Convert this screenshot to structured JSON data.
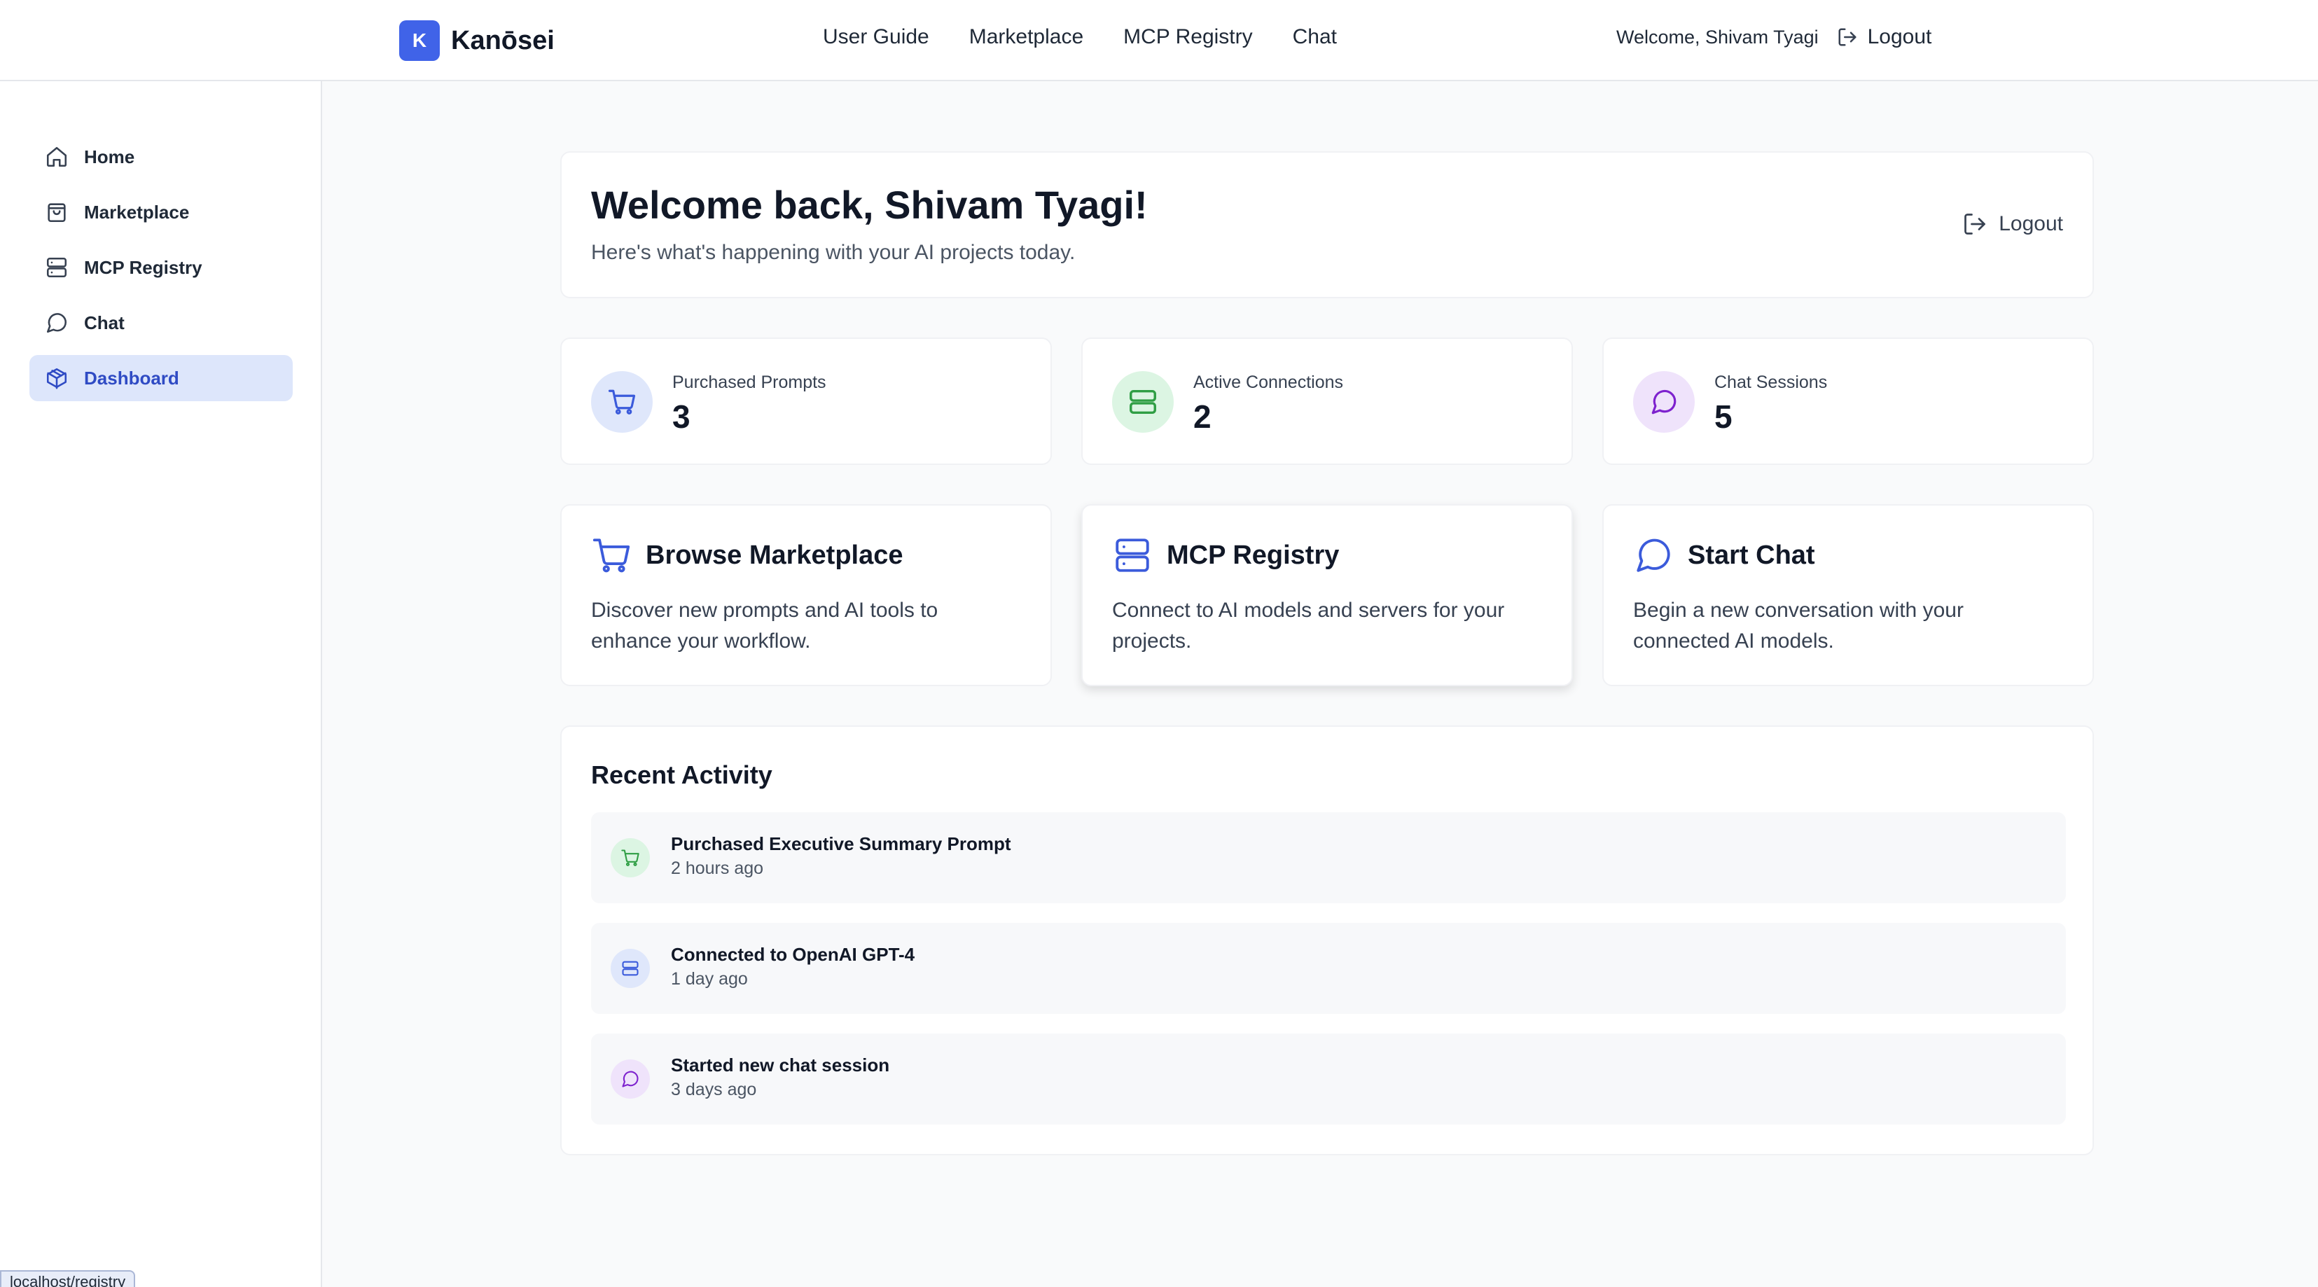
{
  "header": {
    "brand_letter": "K",
    "brand_name": "Kanōsei",
    "nav": [
      "User Guide",
      "Marketplace",
      "MCP Registry",
      "Chat"
    ],
    "welcome_text": "Welcome, Shivam Tyagi",
    "logout_label": "Logout"
  },
  "sidebar": {
    "items": [
      {
        "label": "Home",
        "icon": "home-icon"
      },
      {
        "label": "Marketplace",
        "icon": "bag-icon"
      },
      {
        "label": "MCP Registry",
        "icon": "server-icon"
      },
      {
        "label": "Chat",
        "icon": "chat-icon"
      },
      {
        "label": "Dashboard",
        "icon": "cube-icon",
        "active": true
      }
    ]
  },
  "main": {
    "welcome": {
      "title": "Welcome back, Shivam Tyagi!",
      "subtitle": "Here's what's happening with your AI projects today.",
      "logout_label": "Logout"
    },
    "stats": [
      {
        "label": "Purchased Prompts",
        "value": "3",
        "icon": "cart-icon",
        "color": "#3b5bdb",
        "bg": "#dfe7fb"
      },
      {
        "label": "Active Connections",
        "value": "2",
        "icon": "server-icon",
        "color": "#2f9e44",
        "bg": "#dcf5e3"
      },
      {
        "label": "Chat Sessions",
        "value": "5",
        "icon": "chat-icon",
        "color": "#7e22ce",
        "bg": "#efe3fb"
      }
    ],
    "actions": [
      {
        "title": "Browse Marketplace",
        "description": "Discover new prompts and AI tools to enhance your workflow.",
        "icon": "cart-icon"
      },
      {
        "title": "MCP Registry",
        "description": "Connect to AI models and servers for your projects.",
        "icon": "server-icon"
      },
      {
        "title": "Start Chat",
        "description": "Begin a new conversation with your connected AI models.",
        "icon": "chat-icon"
      }
    ],
    "recent_activity": {
      "title": "Recent Activity",
      "items": [
        {
          "title": "Purchased Executive Summary Prompt",
          "time": "2 hours ago",
          "icon": "cart-icon",
          "color": "#2f9e44",
          "bg": "#dcf5e3"
        },
        {
          "title": "Connected to OpenAI GPT-4",
          "time": "1 day ago",
          "icon": "server-icon",
          "color": "#3b5bdb",
          "bg": "#dfe7fb"
        },
        {
          "title": "Started new chat session",
          "time": "3 days ago",
          "icon": "chat-icon",
          "color": "#7e22ce",
          "bg": "#efe3fb"
        }
      ]
    }
  },
  "status_bar": {
    "url": "localhost/registry"
  },
  "colors": {
    "accent": "#4063e8",
    "active_bg": "#dde6fb",
    "active_text": "#2f4bc4"
  }
}
